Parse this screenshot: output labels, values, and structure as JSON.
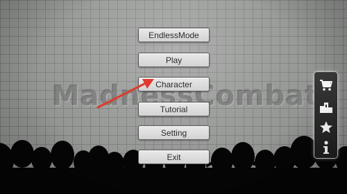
{
  "watermark": "MadnessCombat",
  "menu": {
    "endless_mode": "EndlessMode",
    "play": "Play",
    "character": "Character",
    "tutorial": "Tutorial",
    "setting": "Setting",
    "exit": "Exit"
  },
  "side_panel": {
    "icons": [
      "cart-icon",
      "podium-icon",
      "star-icon",
      "info-icon"
    ]
  },
  "annotation": {
    "color": "#e03a2f",
    "points_to": "Character"
  },
  "colors": {
    "background": "#8f918f",
    "button": "#dedede",
    "panel": "#2a2a2a",
    "silhouette": "#050505"
  }
}
